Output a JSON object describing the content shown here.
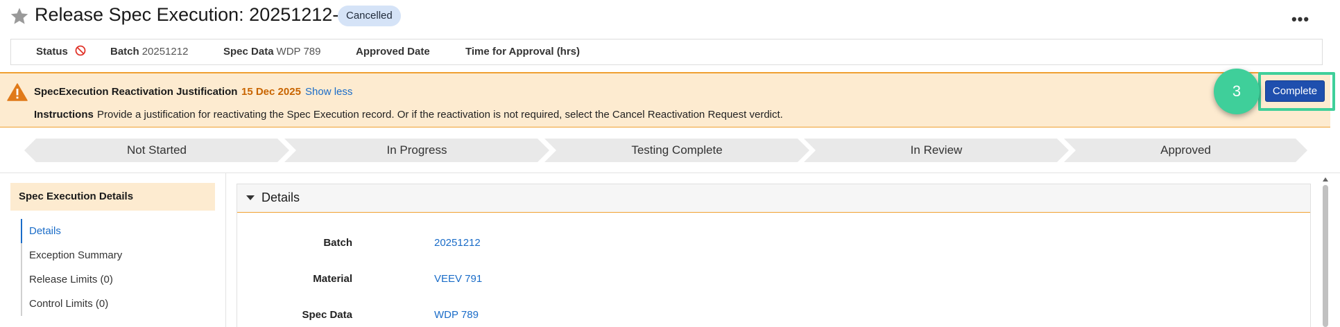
{
  "header": {
    "title": "Release Spec Execution: 20251212-1",
    "state": "Cancelled",
    "more_label": "•••"
  },
  "fieldbar": {
    "status_label": "Status",
    "batch_label": "Batch",
    "batch_value": "20251212",
    "spec_data_label": "Spec Data",
    "spec_data_value": "WDP 789",
    "approved_date_label": "Approved Date",
    "time_for_approval_label": "Time for Approval (hrs)"
  },
  "alert": {
    "title": "SpecExecution Reactivation Justification",
    "date": "15 Dec 2025",
    "toggle": "Show less",
    "instructions_label": "Instructions",
    "instructions_text": "Provide a justification for reactivating the Spec Execution record. Or if the reactivation is not required, select the Cancel Reactivation Request verdict.",
    "complete_button": "Complete",
    "step_number": "3"
  },
  "lifecycle": {
    "stages": [
      "Not Started",
      "In Progress",
      "Testing Complete",
      "In Review",
      "Approved"
    ]
  },
  "leftnav": {
    "header": "Spec Execution Details",
    "items": [
      "Details",
      "Exception Summary",
      "Release Limits (0)",
      "Control Limits (0)"
    ]
  },
  "details": {
    "section_title": "Details",
    "fields": [
      {
        "label": "Batch",
        "value": "20251212"
      },
      {
        "label": "Material",
        "value": "VEEV 791"
      },
      {
        "label": "Spec Data",
        "value": "WDP 789"
      }
    ]
  },
  "colors": {
    "accent_blue": "#1f4fae",
    "link_blue": "#1a6cc8",
    "alert_bg": "#fdebd0",
    "alert_border": "#f0a030",
    "highlight_green": "#3fcf9a",
    "date_orange": "#c86400"
  }
}
